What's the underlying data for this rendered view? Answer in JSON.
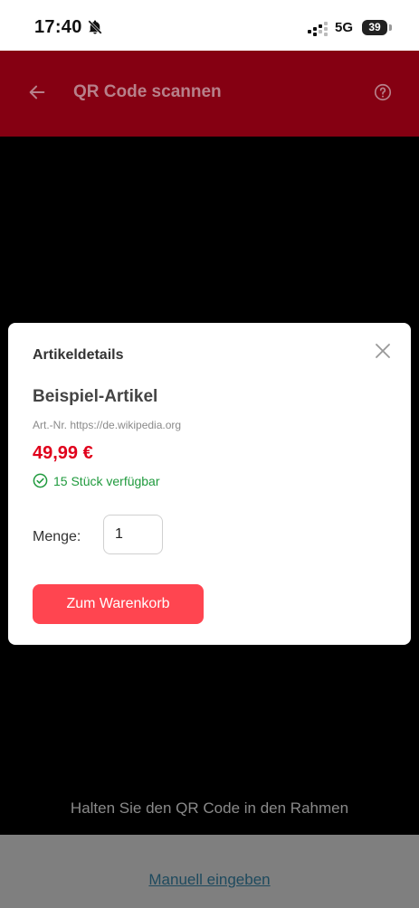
{
  "status_bar": {
    "time": "17:40",
    "network": "5G",
    "battery": "39",
    "icons": [
      "bell-off-icon",
      "signal-icon",
      "battery-icon"
    ]
  },
  "app_bar": {
    "title": "QR Code scannen",
    "back_icon": "arrow-left-icon",
    "help_icon": "help-circle-icon",
    "background_color": "#850012"
  },
  "modal": {
    "title": "Artikeldetails",
    "close_icon": "close-icon",
    "product_name": "Beispiel-Artikel",
    "article_number": "Art.-Nr. https://de.wikipedia.org",
    "price": "49,99 €",
    "stock_icon": "check-circle-icon",
    "stock": "15 Stück verfügbar",
    "quantity_label": "Menge:",
    "quantity_value": "1",
    "add_to_cart_label": "Zum Warenkorb",
    "accent_color": "#ff4550",
    "price_color": "#e0001b",
    "stock_color": "#1f9a3d"
  },
  "scanner": {
    "hint": "Halten Sie den QR Code in den Rahmen"
  },
  "bottom": {
    "manual_link": "Manuell eingeben"
  }
}
